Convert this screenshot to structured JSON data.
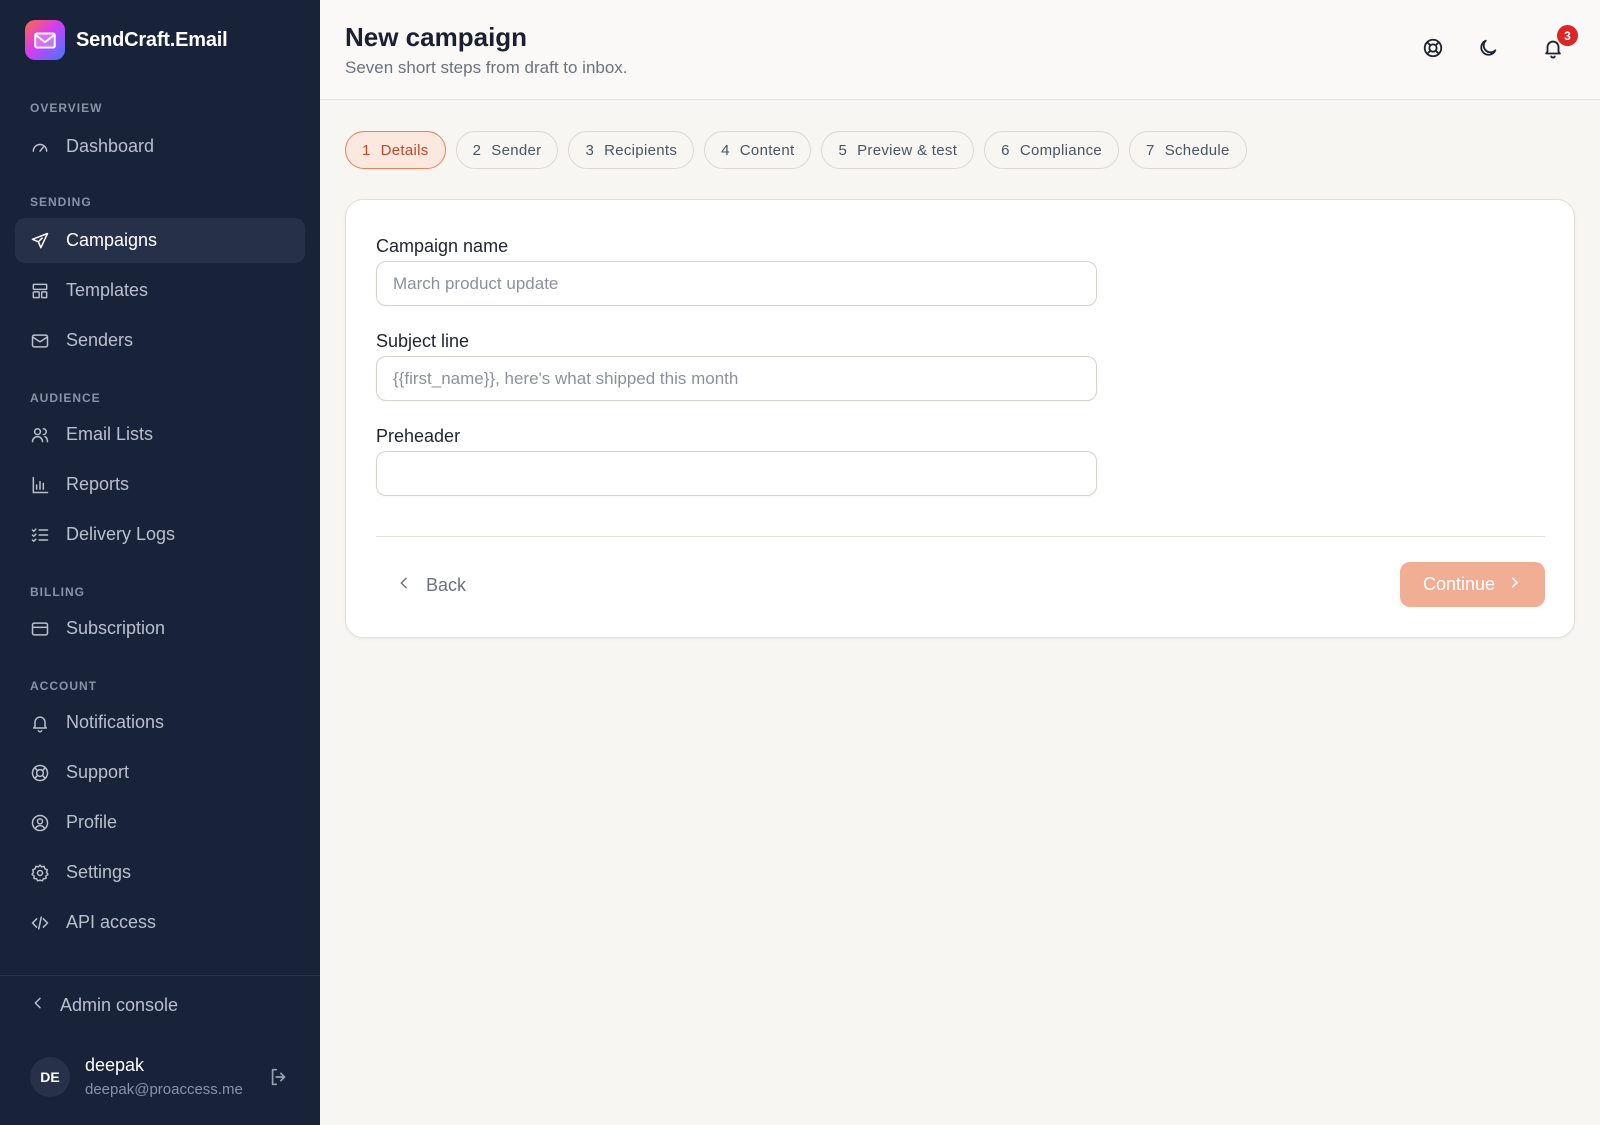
{
  "brand": {
    "name": "SendCraft.Email"
  },
  "sidebar": {
    "sections": [
      {
        "label": "OVERVIEW"
      },
      {
        "label": "SENDING"
      },
      {
        "label": "AUDIENCE"
      },
      {
        "label": "BILLING"
      },
      {
        "label": "ACCOUNT"
      }
    ],
    "items": [
      {
        "label": "Dashboard",
        "icon": "gauge-icon"
      },
      {
        "label": "Campaigns",
        "icon": "send-icon",
        "active": true
      },
      {
        "label": "Templates",
        "icon": "layout-icon"
      },
      {
        "label": "Senders",
        "icon": "mail-icon"
      },
      {
        "label": "Email Lists",
        "icon": "users-icon"
      },
      {
        "label": "Reports",
        "icon": "bar-chart-icon"
      },
      {
        "label": "Delivery Logs",
        "icon": "list-check-icon"
      },
      {
        "label": "Subscription",
        "icon": "credit-card-icon"
      },
      {
        "label": "Notifications",
        "icon": "bell-icon"
      },
      {
        "label": "Support",
        "icon": "lifebuoy-icon"
      },
      {
        "label": "Profile",
        "icon": "user-circle-icon"
      },
      {
        "label": "Settings",
        "icon": "gear-icon"
      },
      {
        "label": "API access",
        "icon": "code-icon"
      }
    ],
    "admin_console": "Admin console",
    "user": {
      "initials": "DE",
      "name": "deepak",
      "email": "deepak@proaccess.me"
    }
  },
  "header": {
    "title": "New campaign",
    "subtitle": "Seven short steps from draft to inbox.",
    "notification_count": "3"
  },
  "steps": [
    {
      "num": "1",
      "label": "Details",
      "active": true
    },
    {
      "num": "2",
      "label": "Sender"
    },
    {
      "num": "3",
      "label": "Recipients"
    },
    {
      "num": "4",
      "label": "Content"
    },
    {
      "num": "5",
      "label": "Preview & test"
    },
    {
      "num": "6",
      "label": "Compliance"
    },
    {
      "num": "7",
      "label": "Schedule"
    }
  ],
  "form": {
    "campaign_name": {
      "label": "Campaign name",
      "placeholder": "March product update"
    },
    "subject_line": {
      "label": "Subject line",
      "placeholder": "{{first_name}}, here's what shipped this month"
    },
    "preheader": {
      "label": "Preheader",
      "placeholder": ""
    },
    "back_label": "Back",
    "continue_label": "Continue"
  },
  "colors": {
    "sidebar_bg": "#182238",
    "accent": "#e8825a",
    "continue_bg": "#f2ae94",
    "badge": "#dc2626"
  }
}
